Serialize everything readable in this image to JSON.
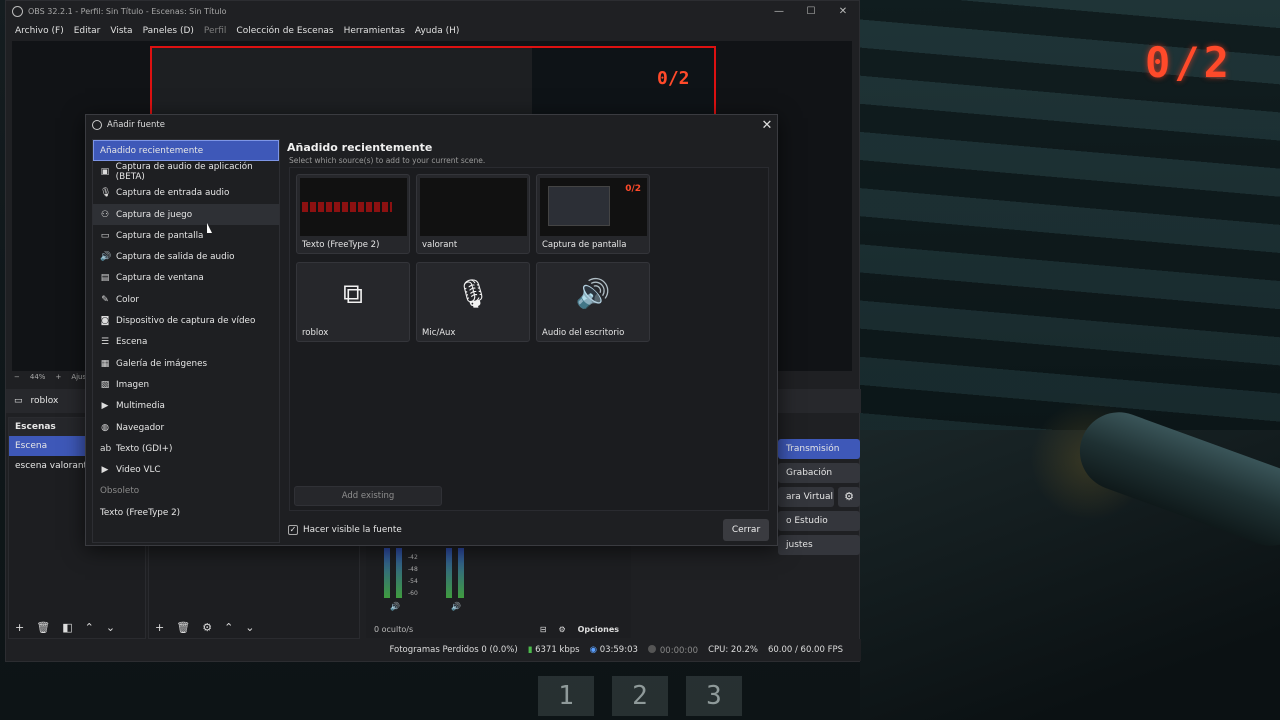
{
  "background": {
    "score": "0/2",
    "round_numbers": [
      "1",
      "2",
      "3"
    ]
  },
  "obs": {
    "title": "OBS 32.2.1 - Perfil: Sin Título - Escenas: Sin Título",
    "menu": [
      {
        "label": "Archivo (F)",
        "enabled": true
      },
      {
        "label": "Editar",
        "enabled": true
      },
      {
        "label": "Vista",
        "enabled": true
      },
      {
        "label": "Paneles (D)",
        "enabled": true
      },
      {
        "label": "Perfil",
        "enabled": false
      },
      {
        "label": "Colección de Escenas",
        "enabled": true
      },
      {
        "label": "Herramientas",
        "enabled": true
      },
      {
        "label": "Ayuda (H)",
        "enabled": true
      }
    ],
    "preview_score": "0/2",
    "zoom": "44%",
    "zoom_label": "Ajus",
    "selected_source": "roblox",
    "scenes": {
      "header": "Escenas",
      "items": [
        "Escena",
        "escena valorant"
      ],
      "active_index": 0
    },
    "controls": {
      "stream": "Transmisión",
      "record": "Grabación",
      "virtual_cam": "ara Virtual",
      "studio": "o Estudio",
      "settings": "justes"
    },
    "mixer": {
      "hidden_count": "0 oculto/s",
      "options_label": "Opciones",
      "ticks": [
        "-42",
        "-48",
        "-54",
        "-60"
      ]
    },
    "status": {
      "dropped_frames": "Fotogramas Perdidos 0 (0.0%)",
      "bitrate": "6371 kbps",
      "stream_time": "03:59:03",
      "record_time": "00:00:00",
      "cpu": "CPU: 20.2%",
      "fps": "60.00 / 60.00 FPS"
    }
  },
  "dialog": {
    "title": "Añadir fuente",
    "source_types": [
      {
        "label": "Añadido recientemente",
        "icon": "none",
        "state": "selected"
      },
      {
        "label": "Captura de audio de aplicación (BETA)",
        "icon": "app-audio-icon",
        "glyph": "▣"
      },
      {
        "label": "Captura de entrada audio",
        "icon": "mic-icon",
        "glyph": "🎙"
      },
      {
        "label": "Captura de juego",
        "icon": "gamepad-icon",
        "glyph": "⚇",
        "state": "hover"
      },
      {
        "label": "Captura de pantalla",
        "icon": "monitor-icon",
        "glyph": "▭"
      },
      {
        "label": "Captura de salida de audio",
        "icon": "speaker-icon",
        "glyph": "🔊"
      },
      {
        "label": "Captura de ventana",
        "icon": "window-icon",
        "glyph": "▤"
      },
      {
        "label": "Color",
        "icon": "brush-icon",
        "glyph": "✎"
      },
      {
        "label": "Dispositivo de captura de vídeo",
        "icon": "camera-icon",
        "glyph": "◙"
      },
      {
        "label": "Escena",
        "icon": "list-icon",
        "glyph": "☰"
      },
      {
        "label": "Galería de imágenes",
        "icon": "gallery-icon",
        "glyph": "▦"
      },
      {
        "label": "Imagen",
        "icon": "image-icon",
        "glyph": "▧"
      },
      {
        "label": "Multimedia",
        "icon": "play-icon",
        "glyph": "▶"
      },
      {
        "label": "Navegador",
        "icon": "globe-icon",
        "glyph": "◍"
      },
      {
        "label": "Texto (GDI+)",
        "icon": "text-icon",
        "glyph": "ab"
      },
      {
        "label": "Video VLC",
        "icon": "play-icon",
        "glyph": "▶"
      },
      {
        "label": "Obsoleto",
        "icon": "none",
        "state": "header"
      },
      {
        "label": "Texto (FreeType 2)",
        "icon": "none"
      }
    ],
    "recent": {
      "title": "Añadido recientemente",
      "subtitle": "Select which source(s) to add to your current scene.",
      "tiles": [
        {
          "label": "Texto (FreeType 2)",
          "kind": "text-thumb"
        },
        {
          "label": "valorant",
          "kind": "valorant-thumb"
        },
        {
          "label": "Captura de pantalla",
          "kind": "screen-thumb"
        },
        {
          "label": "roblox",
          "kind": "window-icon",
          "glyph": "⧉"
        },
        {
          "label": "Mic/Aux",
          "kind": "mic-icon",
          "glyph": "🎙"
        },
        {
          "label": "Audio del escritorio",
          "kind": "speaker-icon",
          "glyph": "🔊"
        }
      ],
      "add_existing": "Add existing"
    },
    "visible_checkbox": {
      "label": "Hacer visible la fuente",
      "checked": true
    },
    "close_label": "Cerrar"
  }
}
